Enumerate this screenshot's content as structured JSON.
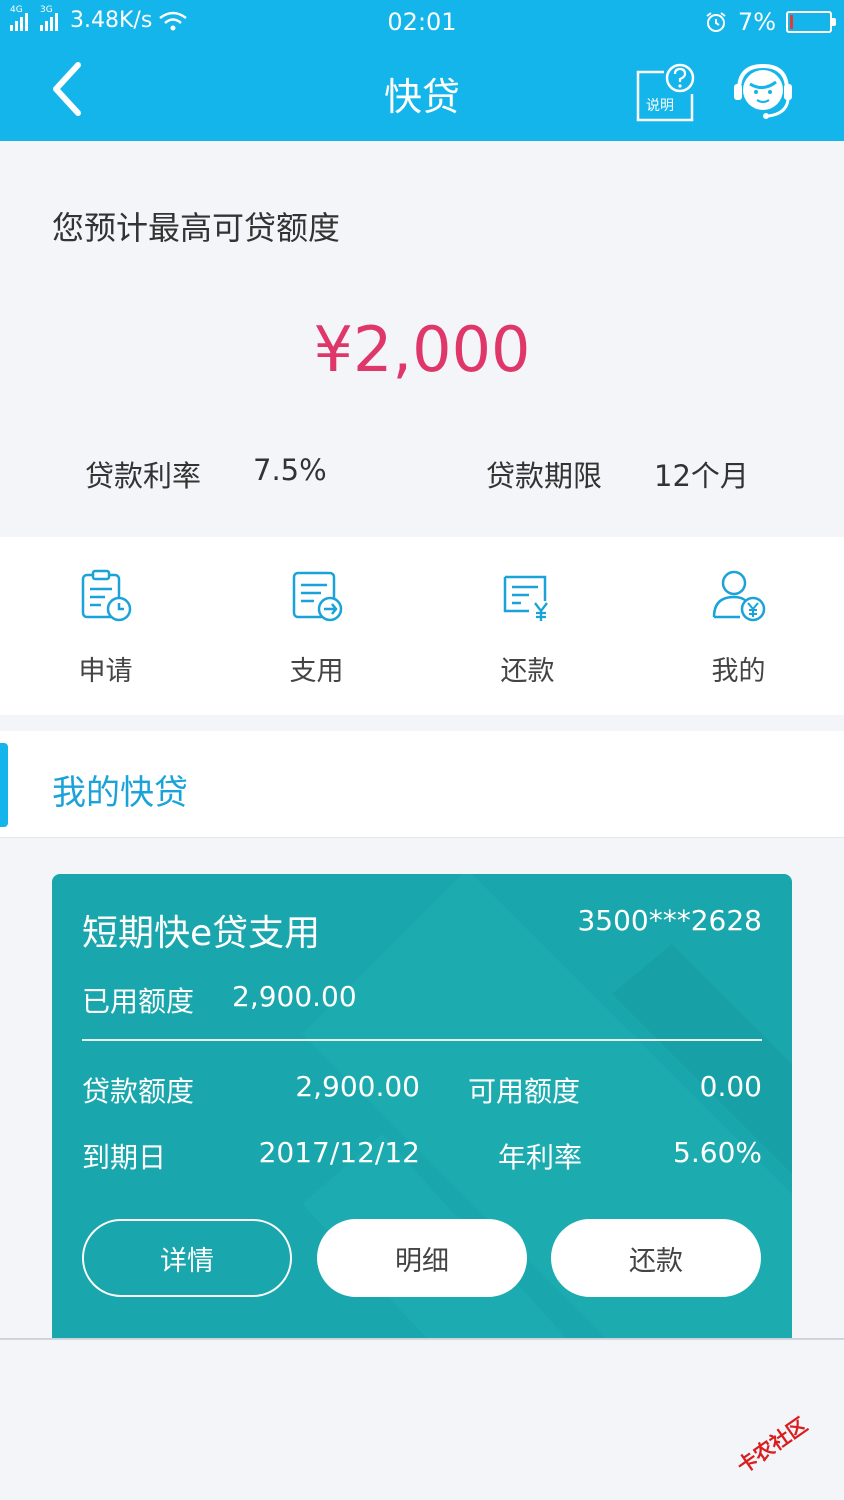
{
  "status_bar": {
    "net_left": "4G",
    "net_right": "3G",
    "speed": "3.48K/s",
    "time": "02:01",
    "battery": "7%",
    "battery_level": 0.07
  },
  "nav": {
    "title": "快贷",
    "help_label": "说明"
  },
  "quota": {
    "label": "您预计最高可贷额度",
    "amount": "¥2,000",
    "rate_label": "贷款利率",
    "rate_value": "7.5%",
    "term_label": "贷款期限",
    "term_value": "12个月"
  },
  "menu": [
    {
      "label": "申请",
      "icon": "apply-doc-clock-icon"
    },
    {
      "label": "支用",
      "icon": "use-doc-arrow-icon"
    },
    {
      "label": "还款",
      "icon": "repay-doc-yen-icon"
    },
    {
      "label": "我的",
      "icon": "user-yen-icon"
    }
  ],
  "section": {
    "title": "我的快贷"
  },
  "card": {
    "title": "短期快e贷支用",
    "account": "3500***2628",
    "used_label": "已用额度",
    "used_value": "2,900.00",
    "loan_label": "贷款额度",
    "loan_value": "2,900.00",
    "available_label": "可用额度",
    "available_value": "0.00",
    "due_label": "到期日",
    "due_value": "2017/12/12",
    "annual_rate_label": "年利率",
    "annual_rate_value": "5.60%",
    "buttons": {
      "detail": "详情",
      "breakdown": "明细",
      "repay": "还款"
    }
  },
  "watermark": "卡农社区",
  "colors": {
    "header": "#13b5ea",
    "amount": "#e0376b",
    "card": "#19a6ac",
    "section_title": "#1aa3d9"
  }
}
